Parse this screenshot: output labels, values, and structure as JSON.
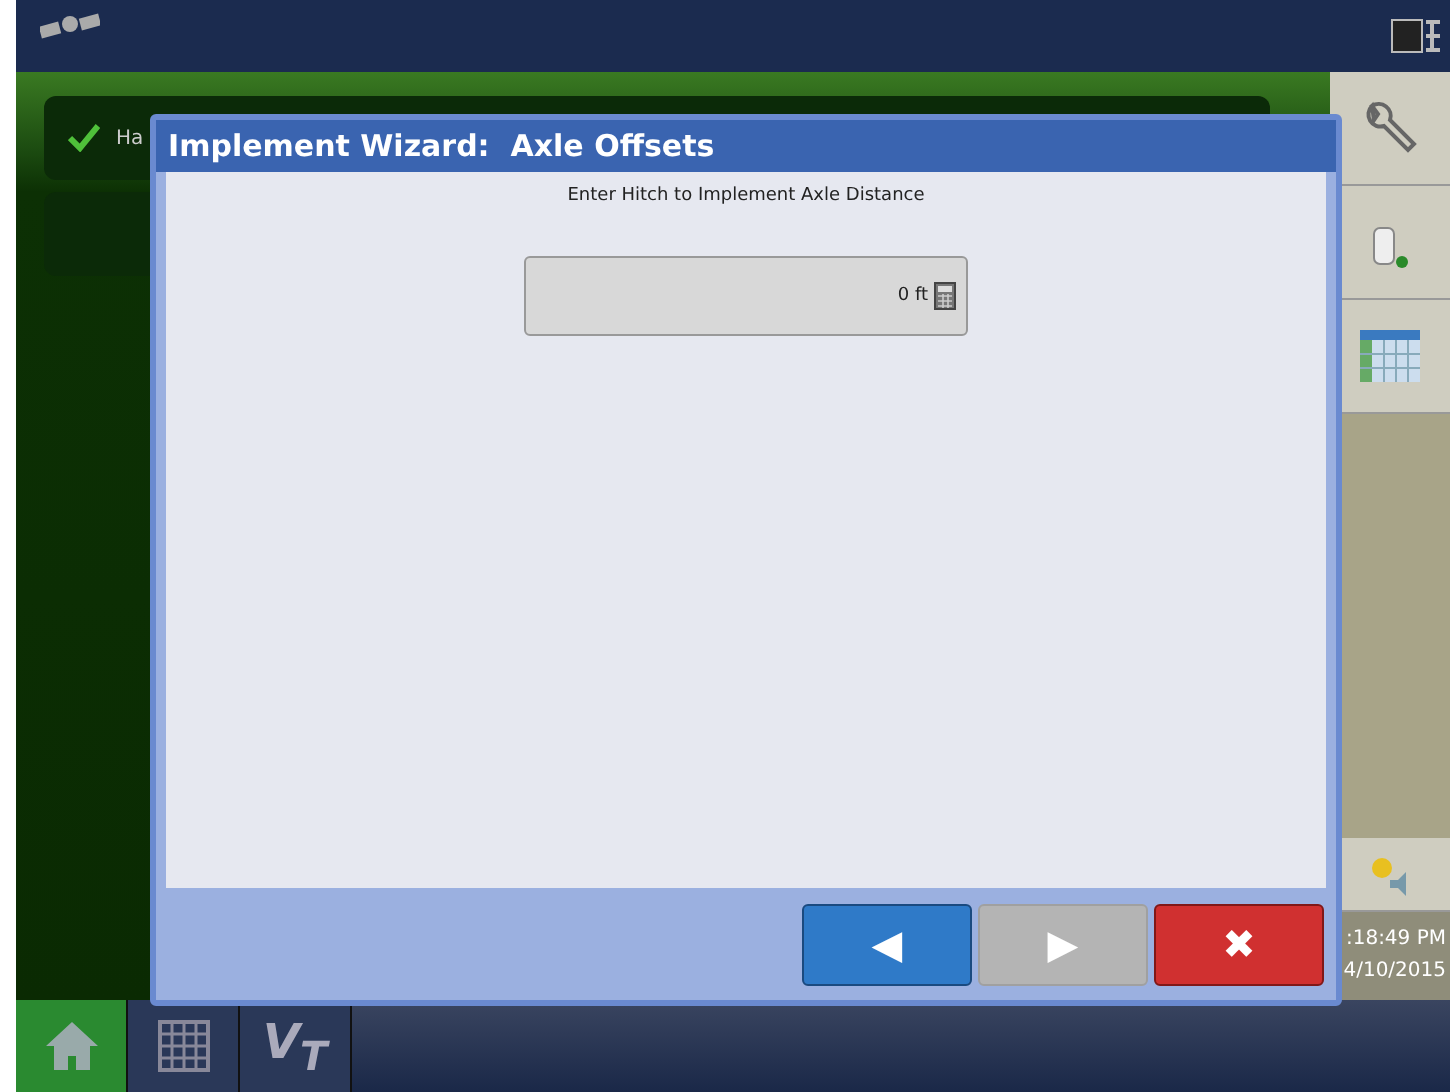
{
  "background_list": {
    "items": [
      {
        "label": "Ha",
        "checked": true
      },
      {
        "checked": false
      }
    ]
  },
  "sidebar": {
    "clock": {
      "time": ":18:49 PM",
      "date": "4/10/2015"
    }
  },
  "dialog": {
    "title": "Implement Wizard:  Axle Offsets",
    "prompt": "Enter Hitch to Implement Axle Distance",
    "field": {
      "value": "0 ft"
    },
    "buttons": [
      {
        "kind": "back",
        "symbol": "◀",
        "disabled": false
      },
      {
        "kind": "next",
        "symbol": "▶",
        "disabled": true
      },
      {
        "kind": "cancel",
        "symbol": "✖",
        "disabled": false
      }
    ]
  },
  "taskbar": {
    "tabs": [
      {
        "kind": "home",
        "selected": true
      },
      {
        "kind": "grid",
        "selected": false
      },
      {
        "kind": "vt",
        "label": "V$_{T}$",
        "selected": false
      }
    ]
  }
}
